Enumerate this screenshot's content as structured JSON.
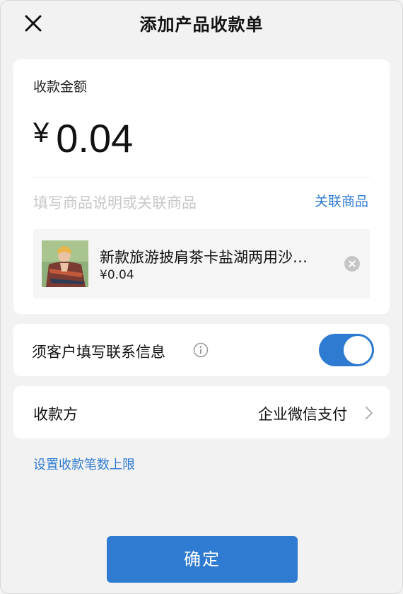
{
  "header": {
    "title": "添加产品收款单",
    "close_icon": "close-icon"
  },
  "amount": {
    "label": "收款金额",
    "currency_symbol": "¥",
    "value": "0.04"
  },
  "description": {
    "placeholder": "填写商品说明或关联商品",
    "link_label": "关联商品"
  },
  "product": {
    "name": "新款旅游披肩茶卡盐湖两用沙…",
    "price": "¥0.04",
    "remove_icon": "remove-circle-icon"
  },
  "contact": {
    "label": "须客户填写联系信息",
    "info_icon": "info-icon",
    "toggle_on": true
  },
  "payee": {
    "label": "收款方",
    "value": "企业微信支付",
    "chevron_icon": "chevron-right-icon"
  },
  "limit_link": "设置收款笔数上限",
  "confirm_button": "确定",
  "colors": {
    "accent": "#2e7bd1",
    "background": "#f2f2f2",
    "card": "#ffffff"
  }
}
